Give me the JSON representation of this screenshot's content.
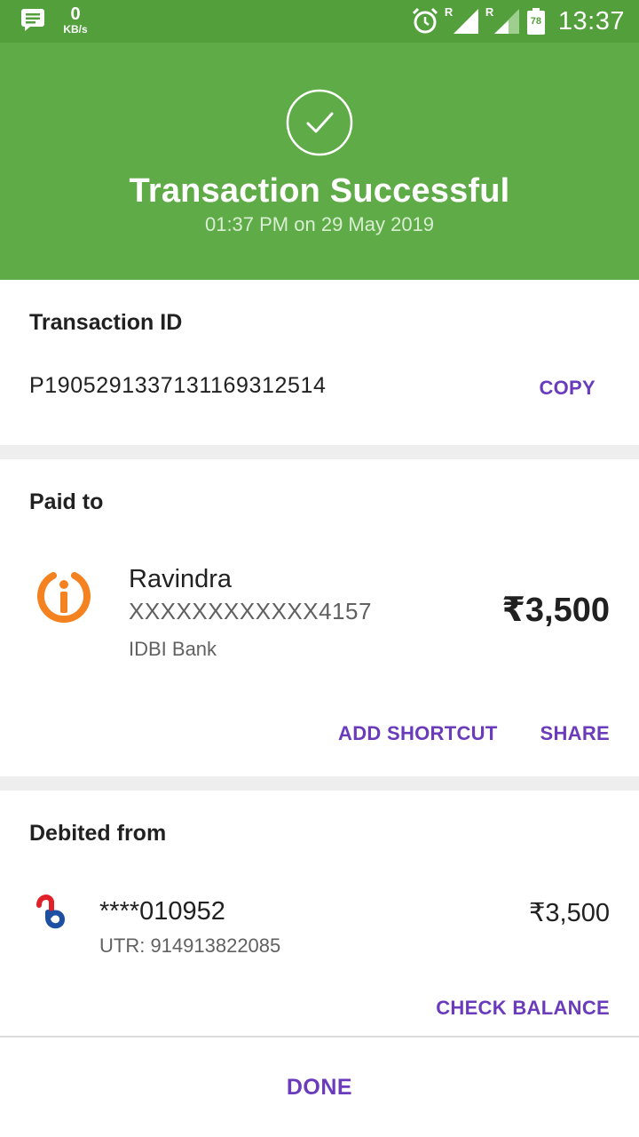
{
  "status_bar": {
    "speed_value": "0",
    "speed_unit": "KB/s",
    "roaming_1": "R",
    "roaming_2": "R",
    "battery_level": "78",
    "time": "13:37",
    "icons": [
      "message-icon",
      "alarm-icon",
      "signal-icon",
      "signal-icon",
      "battery-icon"
    ]
  },
  "header": {
    "title": "Transaction Successful",
    "subtitle": "01:37 PM on 29 May 2019",
    "icon": "check-circle-icon"
  },
  "transaction": {
    "label": "Transaction ID",
    "id": "P1905291337131169312514",
    "copy_label": "COPY"
  },
  "paid_to": {
    "label": "Paid to",
    "name": "Ravindra",
    "account": "XXXXXXXXXXXX4157",
    "bank": "IDBI Bank",
    "amount": "₹3,500",
    "add_shortcut_label": "ADD SHORTCUT",
    "share_label": "SHARE",
    "logo_icon": "idbi-bank-logo-icon"
  },
  "debited_from": {
    "label": "Debited from",
    "account": "****010952",
    "utr": "UTR: 914913822085",
    "amount": "₹3,500",
    "check_balance_label": "CHECK BALANCE",
    "logo_icon": "bank-logo-icon"
  },
  "footer": {
    "done_label": "DONE"
  },
  "colors": {
    "status_bar": "#529f3b",
    "header": "#5fab48",
    "accent": "#6a3bbb",
    "divider": "#eeeeee",
    "idbi_orange": "#f58220"
  }
}
